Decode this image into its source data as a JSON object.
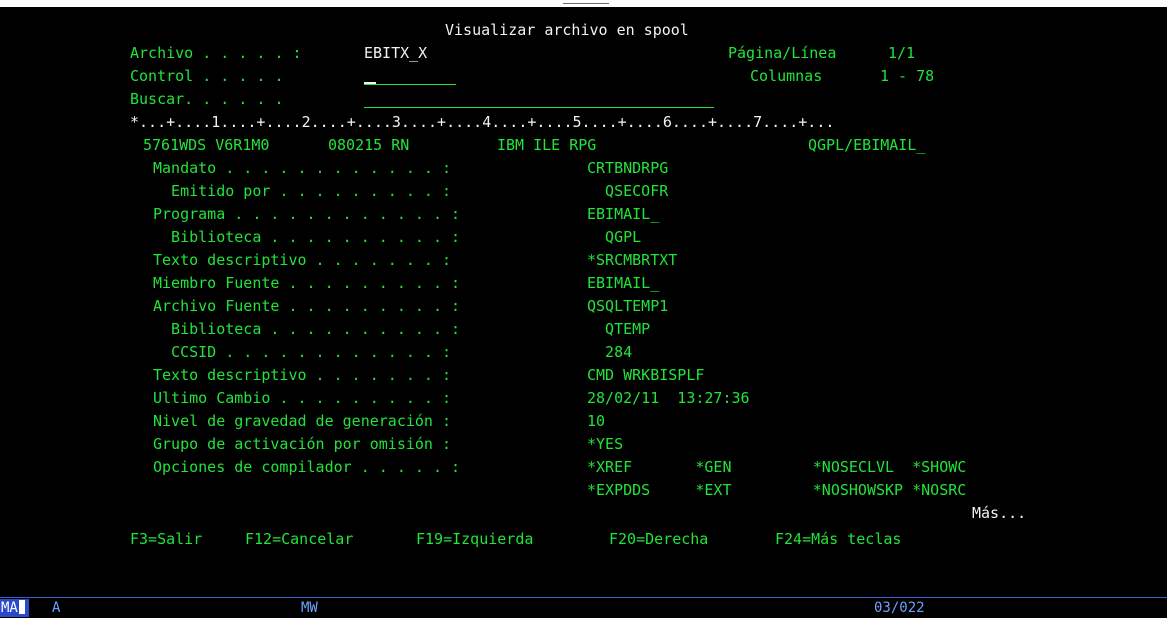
{
  "title": "Visualizar archivo en spool",
  "header": {
    "archivo_label": "Archivo . . . . . :",
    "archivo_value": "EBITX_X",
    "pagina_label": "Página/Línea",
    "pagina_value": "1/1",
    "control_label": "Control . . . . .",
    "control_value": "",
    "columnas_label": "Columnas",
    "columnas_value": "1 - 78",
    "buscar_label": "Buscar. . . . . .",
    "buscar_value": ""
  },
  "ruler": "*...+....1....+....2....+....3....+....4....+....5....+....6....+....7....+...",
  "spool": {
    "line1": {
      "product": "5761WDS V6R1M0",
      "date": "080215 RN",
      "compiler": "IBM ILE RPG",
      "object": "QGPL/EBIMAIL_"
    },
    "rows": [
      {
        "label": "Mandato . . . . . . . . . . . . :",
        "value": "CRTBNDRPG"
      },
      {
        "label": "  Emitido por . . . . . . . . . :",
        "value": "  QSECOFR"
      },
      {
        "label": "Programa . . . . . . . . . . . . :",
        "value": "EBIMAIL_"
      },
      {
        "label": "  Biblioteca . . . . . . . . . . :",
        "value": "  QGPL"
      },
      {
        "label": "Texto descriptivo . . . . . . . :",
        "value": "*SRCMBRTXT"
      },
      {
        "label": "Miembro Fuente . . . . . . . . . :",
        "value": "EBIMAIL_"
      },
      {
        "label": "Archivo Fuente . . . . . . . . . :",
        "value": "QSQLTEMP1"
      },
      {
        "label": "  Biblioteca . . . . . . . . . . :",
        "value": "  QTEMP"
      },
      {
        "label": "  CCSID . . . . . . . . . . . . :",
        "value": "  284"
      },
      {
        "label": "Texto descriptivo . . . . . . . :",
        "value": "CMD WRKBISPLF"
      },
      {
        "label": "Ultimo Cambio . . . . . . . . . :",
        "value": "28/02/11  13:27:36"
      },
      {
        "label": "Nivel de gravedad de generación :",
        "value": "10"
      },
      {
        "label": "Grupo de activación por omisión :",
        "value": "*YES"
      },
      {
        "label": "Opciones de compilador . . . . . :",
        "value": "*XREF       *GEN         *NOSECLVL  *SHOWC"
      }
    ],
    "continuation": "*EXPDDS     *EXT         *NOSHOWSKP *NOSRC"
  },
  "more": "Más...",
  "function_keys": [
    "F3=Salir",
    "F12=Cancelar",
    "F19=Izquierda",
    "F20=Derecha",
    "F24=Más teclas"
  ],
  "status": {
    "mode": "MA",
    "session": "A",
    "indicator": "MW",
    "cursor_position": "03/022"
  },
  "colors": {
    "field_text": "#22e33a",
    "heading_text": "#f2f2f2",
    "status_text": "#6ea0ff",
    "background": "#000000"
  }
}
